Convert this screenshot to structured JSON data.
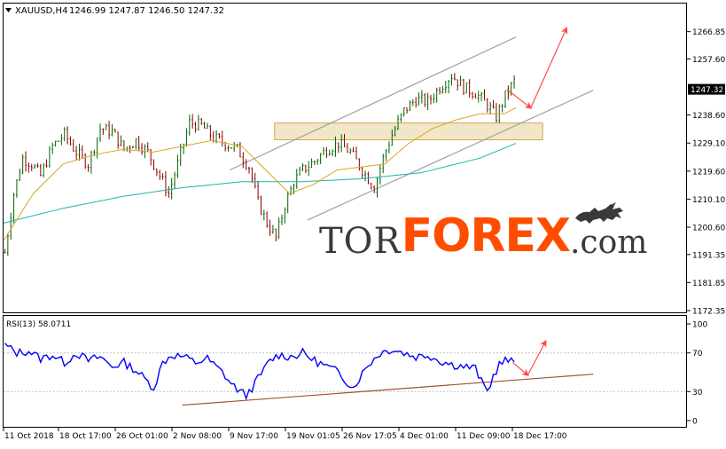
{
  "header": {
    "symbol_label": "XAUUSD,H4",
    "ohlc": "1246.99 1247.87 1246.50 1247.32",
    "menu_icon": "triangle-down-icon"
  },
  "indicator": {
    "label": "RSI(13) 58.0711"
  },
  "watermark": {
    "part1": "TOR",
    "part2": "FOREX",
    "part3": ".com",
    "logo_icon": "bull-icon",
    "brand_color": "#ff4d00"
  },
  "colors": {
    "bull_candle": "#006400",
    "bear_candle": "#8b0000",
    "ma_fast": "#daa520",
    "ma_slow": "#20b2aa",
    "rsi_line": "#0000ff",
    "channel": "#a0a0a0",
    "arrow": "#ff4a4a",
    "zone": "#f0e6c8",
    "zone_border": "#d4a94a",
    "rsi_trend": "#a0522d"
  },
  "chart_data": [
    {
      "type": "candlestick",
      "title": "XAUUSD,H4",
      "y_ticks": [
        "1266.85",
        "1257.60",
        "1247.32",
        "1238.60",
        "1229.10",
        "1219.60",
        "1210.10",
        "1200.60",
        "1191.35",
        "1181.85",
        "1172.35"
      ],
      "current_price": "1247.32",
      "ylim": [
        1172.35,
        1270.5
      ],
      "x_ticks": [
        "11 Oct 2018",
        "18 Oct 17:00",
        "26 Oct 01:00",
        "2 Nov 08:00",
        "9 Nov 17:00",
        "19 Nov 01:05",
        "26 Nov 17:05",
        "4 Dec 01:00",
        "11 Dec 09:00",
        "18 Dec 17:00"
      ],
      "close_path": [
        [
          0,
          1192
        ],
        [
          3,
          1212
        ],
        [
          6,
          1224
        ],
        [
          9,
          1222
        ],
        [
          12,
          1218
        ],
        [
          16,
          1228
        ],
        [
          20,
          1232
        ],
        [
          24,
          1226
        ],
        [
          28,
          1222
        ],
        [
          32,
          1234
        ],
        [
          36,
          1233
        ],
        [
          40,
          1227
        ],
        [
          44,
          1230
        ],
        [
          48,
          1226
        ],
        [
          52,
          1218
        ],
        [
          55,
          1212
        ],
        [
          58,
          1222
        ],
        [
          62,
          1236
        ],
        [
          66,
          1235
        ],
        [
          70,
          1231
        ],
        [
          74,
          1229
        ],
        [
          78,
          1227
        ],
        [
          82,
          1221
        ],
        [
          85,
          1209
        ],
        [
          88,
          1202
        ],
        [
          91,
          1197
        ],
        [
          94,
          1208
        ],
        [
          97,
          1216
        ],
        [
          100,
          1220
        ],
        [
          104,
          1223
        ],
        [
          108,
          1227
        ],
        [
          112,
          1229
        ],
        [
          116,
          1226
        ],
        [
          120,
          1220
        ],
        [
          124,
          1214
        ],
        [
          127,
          1224
        ],
        [
          130,
          1232
        ],
        [
          134,
          1240
        ],
        [
          138,
          1244
        ],
        [
          142,
          1243
        ],
        [
          146,
          1248
        ],
        [
          150,
          1252
        ],
        [
          154,
          1248
        ],
        [
          158,
          1246
        ],
        [
          162,
          1242
        ],
        [
          165,
          1238
        ],
        [
          168,
          1245
        ],
        [
          171,
          1250
        ]
      ],
      "ma_fast_path": [
        [
          0,
          1196
        ],
        [
          10,
          1212
        ],
        [
          20,
          1222
        ],
        [
          30,
          1225
        ],
        [
          40,
          1227
        ],
        [
          50,
          1226
        ],
        [
          60,
          1228
        ],
        [
          70,
          1230
        ],
        [
          80,
          1228
        ],
        [
          88,
          1220
        ],
        [
          96,
          1212
        ],
        [
          104,
          1215
        ],
        [
          112,
          1220
        ],
        [
          120,
          1221
        ],
        [
          128,
          1222
        ],
        [
          136,
          1229
        ],
        [
          144,
          1234
        ],
        [
          152,
          1237
        ],
        [
          160,
          1239
        ],
        [
          168,
          1239
        ],
        [
          172,
          1241
        ]
      ],
      "ma_slow_path": [
        [
          0,
          1202
        ],
        [
          20,
          1207
        ],
        [
          40,
          1211
        ],
        [
          60,
          1214
        ],
        [
          80,
          1216
        ],
        [
          100,
          1216
        ],
        [
          120,
          1217
        ],
        [
          140,
          1219
        ],
        [
          160,
          1224
        ],
        [
          172,
          1229
        ]
      ],
      "channel_upper": [
        [
          76,
          1220
        ],
        [
          172,
          1265
        ]
      ],
      "channel_lower": [
        [
          102,
          1203
        ],
        [
          198,
          1247
        ]
      ],
      "zone": {
        "x0": 91,
        "x1": 181,
        "price_top": 1235.9,
        "price_bottom": 1230.2
      },
      "forecast_arrows": [
        {
          "from": [
            169,
            1247.3
          ],
          "to": [
            177,
            1241
          ]
        },
        {
          "from": [
            177,
            1241
          ],
          "to": [
            189,
            1268
          ]
        }
      ]
    },
    {
      "type": "line",
      "title": "RSI(13) 58.0711",
      "y_ticks": [
        "100",
        "70",
        "30",
        "0"
      ],
      "ylim": [
        0,
        100
      ],
      "levels": [
        30,
        70
      ],
      "path": [
        [
          0,
          78
        ],
        [
          4,
          70
        ],
        [
          8,
          72
        ],
        [
          12,
          64
        ],
        [
          16,
          68
        ],
        [
          20,
          60
        ],
        [
          24,
          70
        ],
        [
          28,
          62
        ],
        [
          32,
          66
        ],
        [
          36,
          56
        ],
        [
          40,
          60
        ],
        [
          44,
          52
        ],
        [
          48,
          40
        ],
        [
          50,
          34
        ],
        [
          53,
          60
        ],
        [
          56,
          68
        ],
        [
          60,
          66
        ],
        [
          64,
          60
        ],
        [
          68,
          64
        ],
        [
          70,
          58
        ],
        [
          73,
          50
        ],
        [
          76,
          38
        ],
        [
          79,
          30
        ],
        [
          81,
          26
        ],
        [
          83,
          34
        ],
        [
          86,
          48
        ],
        [
          89,
          62
        ],
        [
          92,
          68
        ],
        [
          96,
          66
        ],
        [
          100,
          70
        ],
        [
          104,
          62
        ],
        [
          108,
          56
        ],
        [
          112,
          50
        ],
        [
          115,
          40
        ],
        [
          117,
          34
        ],
        [
          119,
          44
        ],
        [
          122,
          58
        ],
        [
          126,
          70
        ],
        [
          130,
          74
        ],
        [
          134,
          70
        ],
        [
          138,
          66
        ],
        [
          142,
          68
        ],
        [
          146,
          62
        ],
        [
          150,
          58
        ],
        [
          154,
          56
        ],
        [
          158,
          54
        ],
        [
          160,
          40
        ],
        [
          162,
          30
        ],
        [
          164,
          46
        ],
        [
          166,
          58
        ],
        [
          168,
          62
        ],
        [
          171,
          60
        ]
      ],
      "trend_line": [
        [
          60,
          16
        ],
        [
          198,
          48
        ]
      ],
      "forecast_arrows": [
        {
          "from": [
            171,
            60
          ],
          "to": [
            176,
            47
          ]
        },
        {
          "from": [
            176,
            47
          ],
          "to": [
            182,
            82
          ]
        }
      ]
    }
  ]
}
